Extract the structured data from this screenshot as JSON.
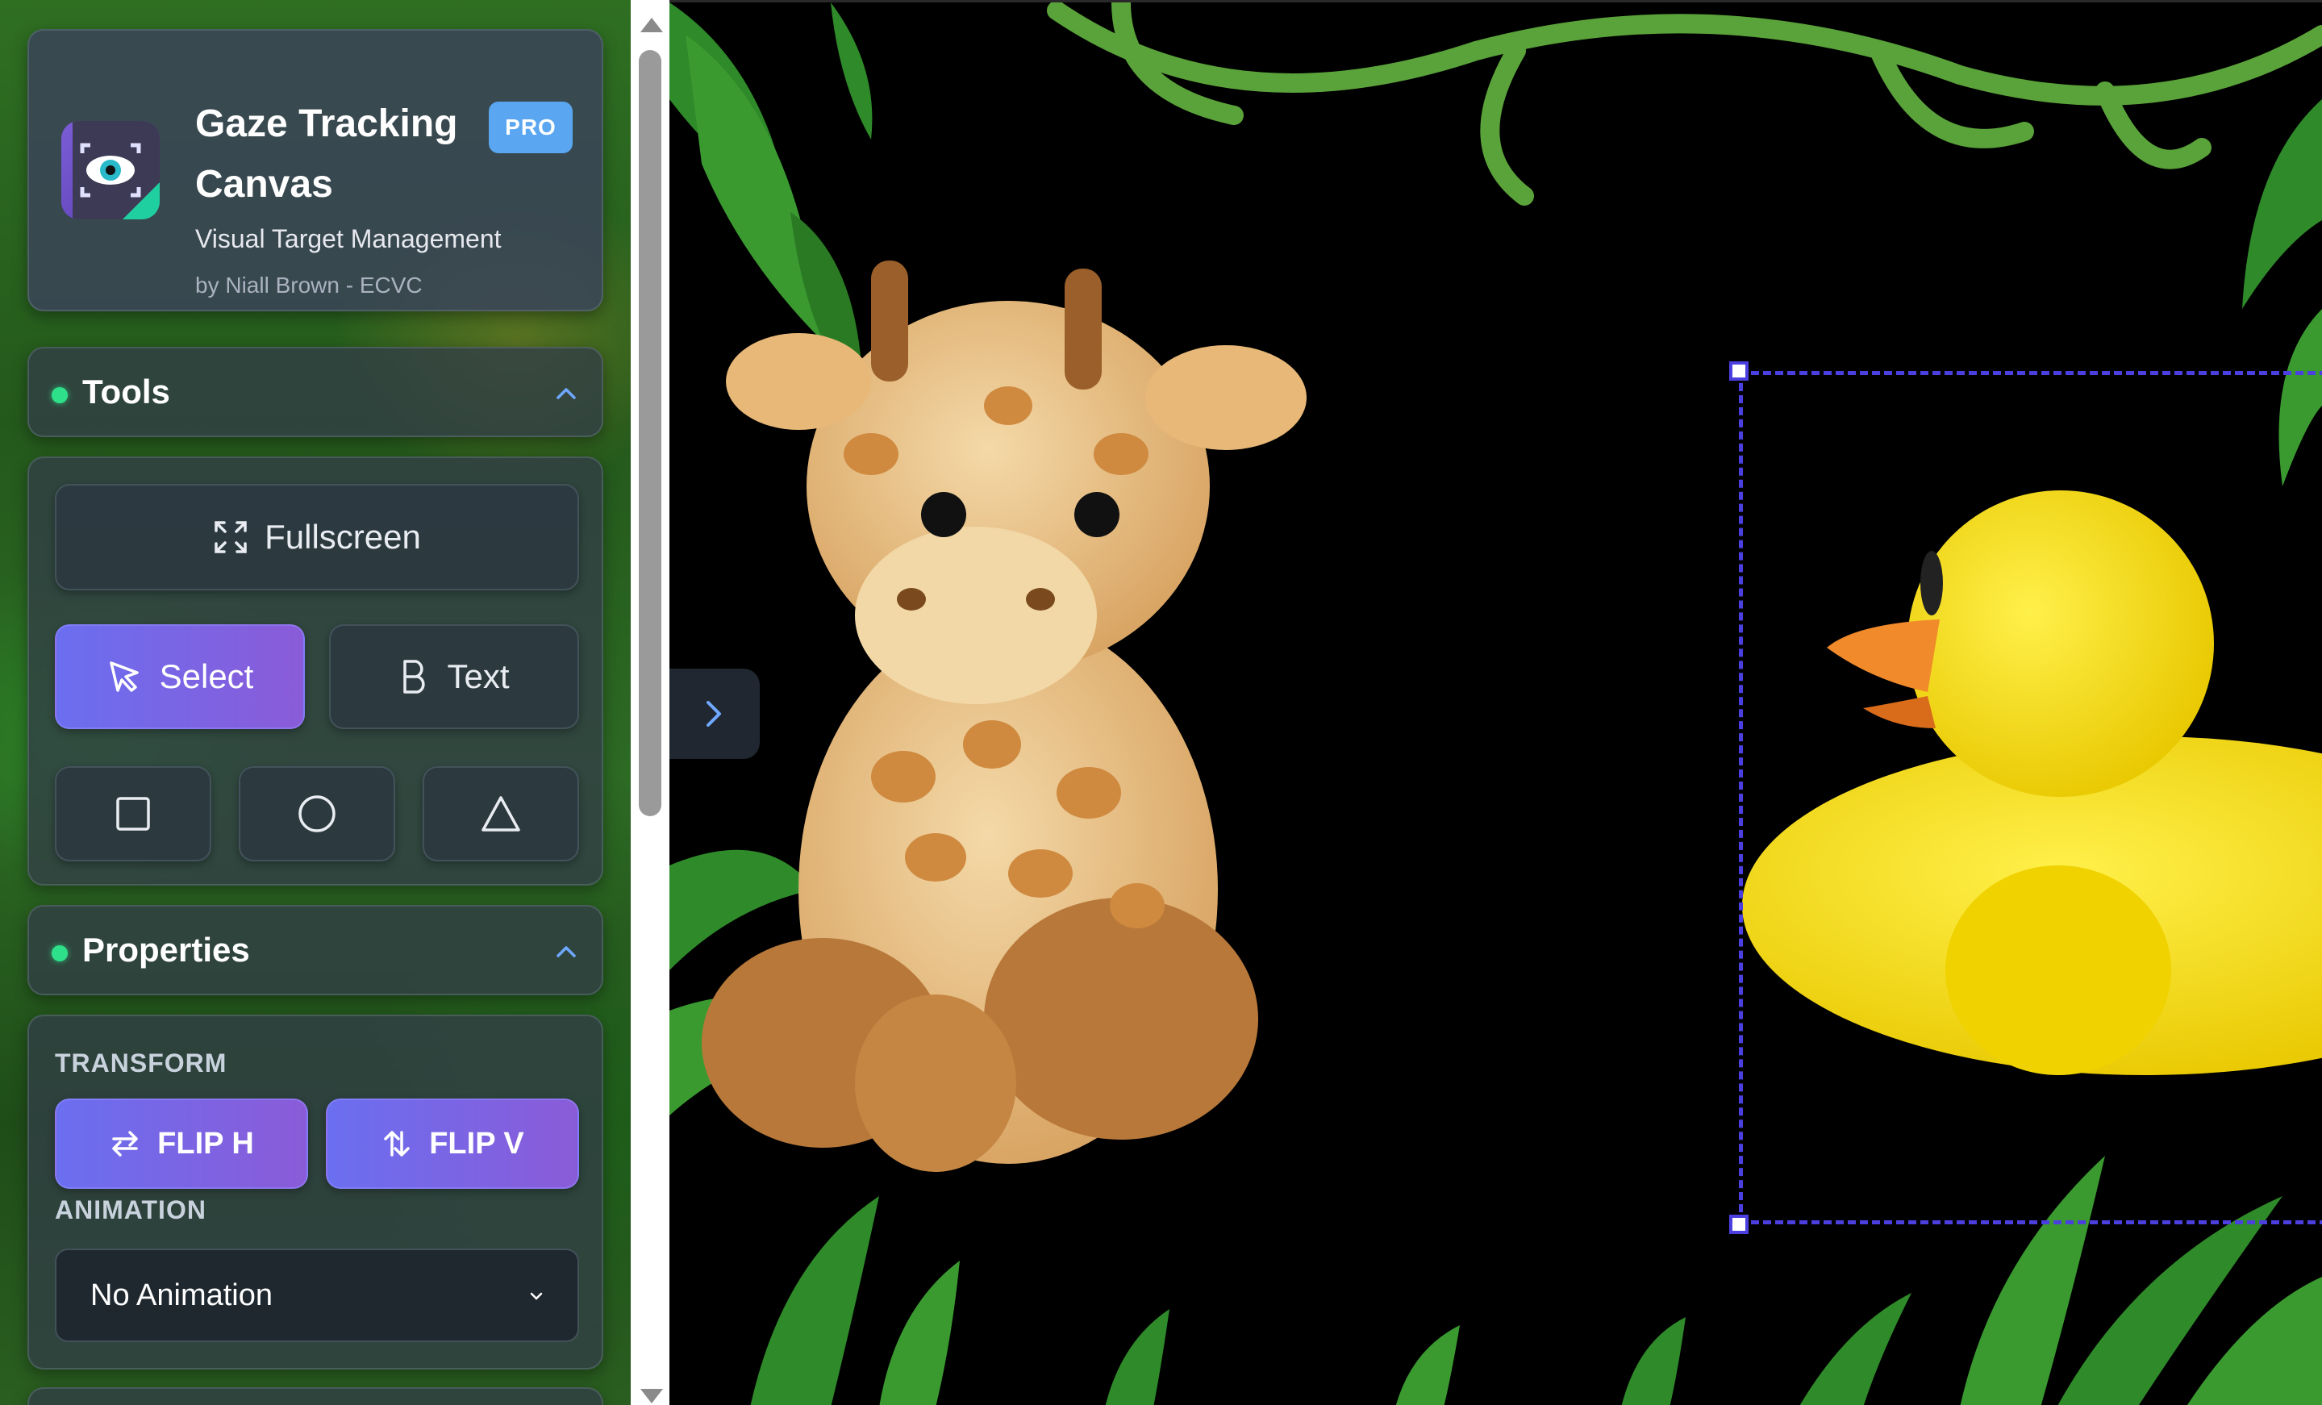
{
  "header": {
    "title_line1": "Gaze Tracking",
    "title_line2": "Canvas",
    "badge": "PRO",
    "subtitle": "Visual Target Management",
    "author": "by Niall Brown - ECVC"
  },
  "tools": {
    "section_label": "Tools",
    "fullscreen_label": "Fullscreen",
    "select_label": "Select",
    "text_label": "Text",
    "shapes": [
      "square",
      "circle",
      "triangle"
    ]
  },
  "properties": {
    "section_label": "Properties",
    "transform_label": "TRANSFORM",
    "flip_h_label": "FLIP H",
    "flip_v_label": "FLIP V",
    "animation_label": "ANIMATION",
    "animation_value": "No Animation"
  },
  "canvas": {
    "objects": [
      "giraffe-plush",
      "rubber-duck"
    ],
    "selected": "rubber-duck",
    "background": "jungle-leaves"
  },
  "colors": {
    "accent": "#6a6ff0",
    "selection": "#4b3fe0",
    "status_dot": "#2fe08a",
    "badge": "#5aa6f0"
  }
}
